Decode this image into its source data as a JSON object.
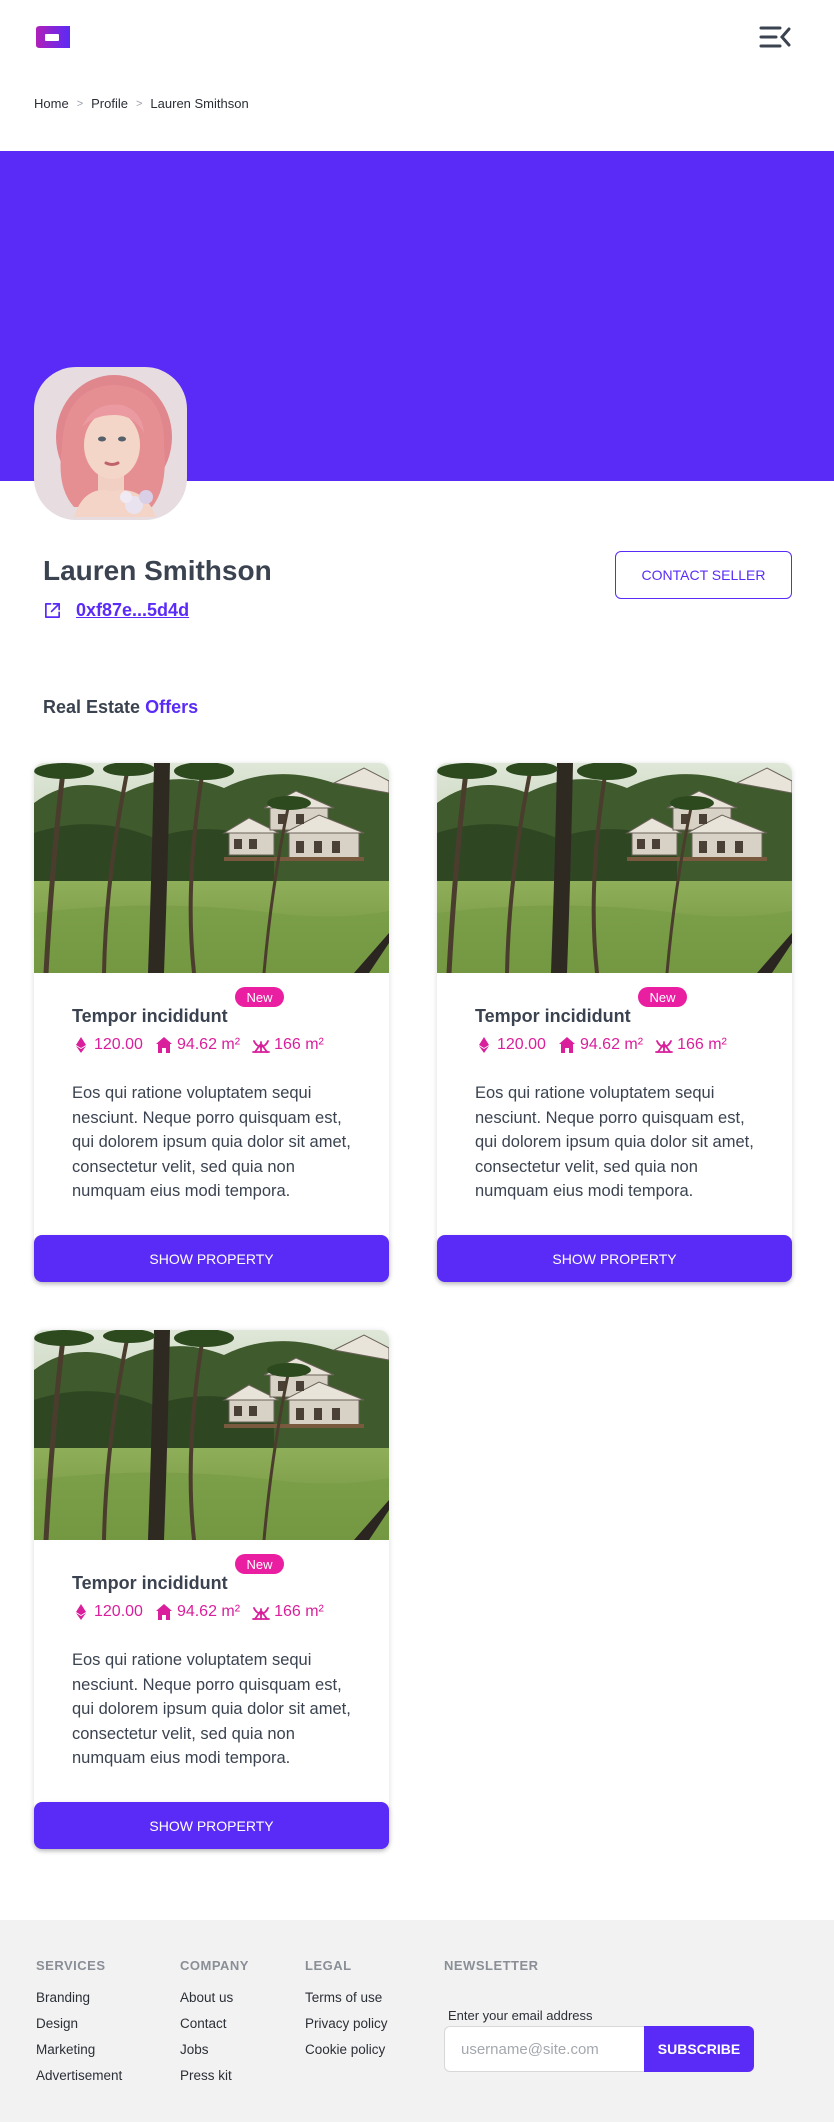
{
  "brand": {
    "accent": "#5a2bf7",
    "pink": "#e91ea0",
    "logo_icon": "logo-icon",
    "menu_icon": "menu-collapse-icon"
  },
  "breadcrumb": {
    "items": [
      "Home",
      "Profile",
      "Lauren Smithson"
    ],
    "separator": ">"
  },
  "profile": {
    "name": "Lauren Smithson",
    "wallet": "0xf87e...5d4d",
    "wallet_icon": "external-link-icon",
    "contact_label": "CONTACT SELLER",
    "banner_color": "#5a2bf7"
  },
  "section": {
    "title_prefix": "Real Estate",
    "title_accent": "Offers"
  },
  "cards": [
    {
      "badge": "New",
      "title": "Tempor incididunt",
      "price": "120.00",
      "area": "94.62 m²",
      "land": "166 m²",
      "description": "Eos qui ratione voluptatem sequi nesciunt. Neque porro quisquam est, qui dolorem ipsum quia dolor sit amet, consectetur velit, sed quia non numquam eius modi tempora.",
      "button": "SHOW PROPERTY"
    },
    {
      "badge": "New",
      "title": "Tempor incididunt",
      "price": "120.00",
      "area": "94.62 m²",
      "land": "166 m²",
      "description": "Eos qui ratione voluptatem sequi nesciunt. Neque porro quisquam est, qui dolorem ipsum quia dolor sit amet, consectetur velit, sed quia non numquam eius modi tempora.",
      "button": "SHOW PROPERTY"
    },
    {
      "badge": "New",
      "title": "Tempor incididunt",
      "price": "120.00",
      "area": "94.62 m²",
      "land": "166 m²",
      "description": "Eos qui ratione voluptatem sequi nesciunt. Neque porro quisquam est, qui dolorem ipsum quia dolor sit amet, consectetur velit, sed quia non numquam eius modi tempora.",
      "button": "SHOW PROPERTY"
    }
  ],
  "footer": {
    "services": {
      "heading": "SERVICES",
      "links": [
        "Branding",
        "Design",
        "Marketing",
        "Advertisement"
      ]
    },
    "company": {
      "heading": "COMPANY",
      "links": [
        "About us",
        "Contact",
        "Jobs",
        "Press kit"
      ]
    },
    "legal": {
      "heading": "LEGAL",
      "links": [
        "Terms of use",
        "Privacy policy",
        "Cookie policy"
      ]
    },
    "newsletter": {
      "heading": "NEWSLETTER",
      "label": "Enter your email address",
      "placeholder": "username@site.com",
      "button": "SUBSCRIBE"
    }
  }
}
